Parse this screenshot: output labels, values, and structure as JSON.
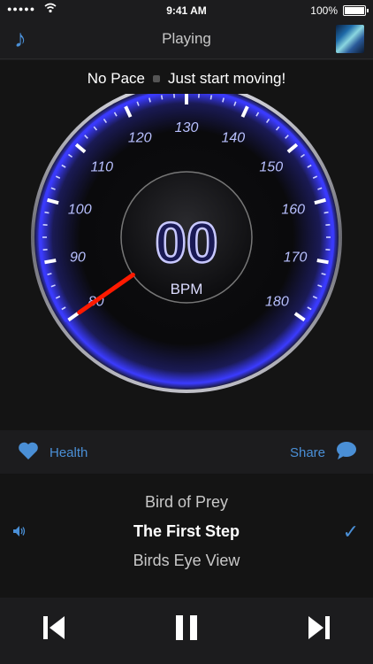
{
  "status_bar": {
    "signal": "●●●●●",
    "time": "9:41 AM",
    "battery": "100%"
  },
  "nav": {
    "title": "Playing"
  },
  "pace": {
    "left": "No Pace",
    "right": "Just start moving!"
  },
  "gauge": {
    "ticks": [
      "80",
      "90",
      "100",
      "110",
      "120",
      "130",
      "140",
      "150",
      "160",
      "170",
      "180"
    ],
    "bpm_value": "00",
    "bpm_label": "BPM",
    "needle_value": 80,
    "accent": "#3b3bff"
  },
  "actions": {
    "health": "Health",
    "share": "Share"
  },
  "tracks": {
    "prev": "Bird of Prey",
    "current": "The First Step",
    "next": "Birds Eye View"
  },
  "controls": {
    "prev": "skip-back-icon",
    "play": "pause-icon",
    "next": "skip-forward-icon"
  }
}
